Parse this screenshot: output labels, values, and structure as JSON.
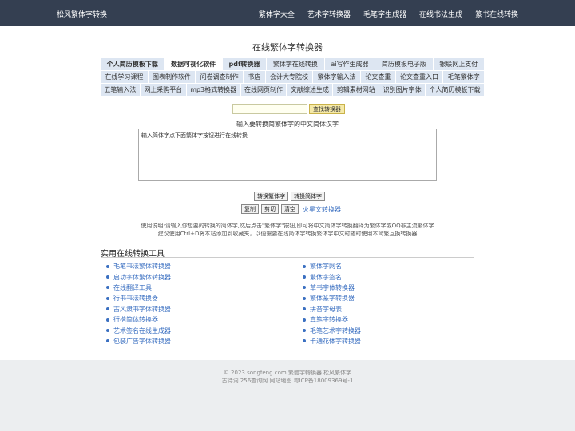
{
  "header": {
    "brand": "松风繁体字转换",
    "nav": [
      "繁体字大全",
      "艺术字转换器",
      "毛笔字生成器",
      "在线书法生成",
      "篆书在线转换"
    ]
  },
  "page_title": "在线繁体字转换器",
  "tag_rows": [
    [
      {
        "label": "个人简历模板下载",
        "bold": true,
        "active": false
      },
      {
        "label": "数据可视化软件",
        "bold": true,
        "active": true
      },
      {
        "label": "pdf转换器",
        "bold": true,
        "active": false
      },
      {
        "label": "繁体字在线转换",
        "bold": false,
        "active": false
      },
      {
        "label": "ai写作生成器",
        "bold": false,
        "active": false
      },
      {
        "label": "简历模板电子版",
        "bold": false,
        "active": false
      },
      {
        "label": "银联网上支付",
        "bold": false,
        "active": false
      }
    ],
    [
      {
        "label": "在线学习课程",
        "bold": false,
        "active": false
      },
      {
        "label": "图表制作软件",
        "bold": false,
        "active": false
      },
      {
        "label": "问卷调查制作",
        "bold": false,
        "active": false
      },
      {
        "label": "书店",
        "bold": false,
        "active": false
      },
      {
        "label": "会计大专院校",
        "bold": false,
        "active": false
      },
      {
        "label": "繁体字输入法",
        "bold": false,
        "active": false
      },
      {
        "label": "论文查重",
        "bold": false,
        "active": false
      },
      {
        "label": "论文查重入口",
        "bold": false,
        "active": false
      },
      {
        "label": "毛笔繁体字",
        "bold": false,
        "active": false
      }
    ],
    [
      {
        "label": "五笔输入法",
        "bold": false,
        "active": false
      },
      {
        "label": "网上采购平台",
        "bold": false,
        "active": false
      },
      {
        "label": "mp3格式转换器",
        "bold": false,
        "active": false
      },
      {
        "label": "在线网页制作",
        "bold": false,
        "active": false
      },
      {
        "label": "文献综述生成",
        "bold": false,
        "active": false
      },
      {
        "label": "剪辑素材网站",
        "bold": false,
        "active": false
      },
      {
        "label": "识别图片字体",
        "bold": false,
        "active": false
      },
      {
        "label": "个人简历模板下载",
        "bold": false,
        "active": false
      }
    ]
  ],
  "search": {
    "value": "",
    "button": "查找转换器"
  },
  "prompt": "输入要转换简繁体字的中文简体汉字",
  "textarea_value": "输入简体字点下面繁体字按钮进行在线转换",
  "buttons": {
    "to_traditional": "转换繁体字",
    "to_simplified": "转换简体字",
    "copy": "复制",
    "cut": "剪切",
    "clear": "清空",
    "fire": "火星文转换器"
  },
  "instructions": {
    "line1": "使用说明:请输入你想要的转换的简体字,然后点击\"繁体字\"按钮,即可将中文简体字转换翻译为繁体字或QQ非主流繁体字",
    "line2": "建议使用Ctrl+D将本站添加到收藏夹，以便需要在线简体字转换繁体字中文时随时使用本简繁互换转换器"
  },
  "tools": {
    "title": "实用在线转换工具",
    "left": [
      "毛笔书法繁体转换器",
      "启功字体繁体转换器",
      "在线翻译工具",
      "行书书法转换器",
      "古风隶书字体转换器",
      "行楷简体转换器",
      "艺术签名在线生成器",
      "包装广告字体转换器"
    ],
    "right": [
      "繁体字网名",
      "繁体字签名",
      "草书字体转换器",
      "繁体篆字转换器",
      "拼音字母表",
      "真笔字转换器",
      "毛笔艺术字转换器",
      "卡通花体字转换器"
    ]
  },
  "footer": {
    "line1": "© 2023 songfeng.com 繁體字轉換器 松风繁体字",
    "line2": "古诗词 256查询网 网站地图 粤ICP备18009369号-1"
  },
  "colors": {
    "topbar": "#343f51",
    "tag_bg": "#dde6f2",
    "link": "#3a6fc1",
    "footer_bg": "#eceef0"
  }
}
